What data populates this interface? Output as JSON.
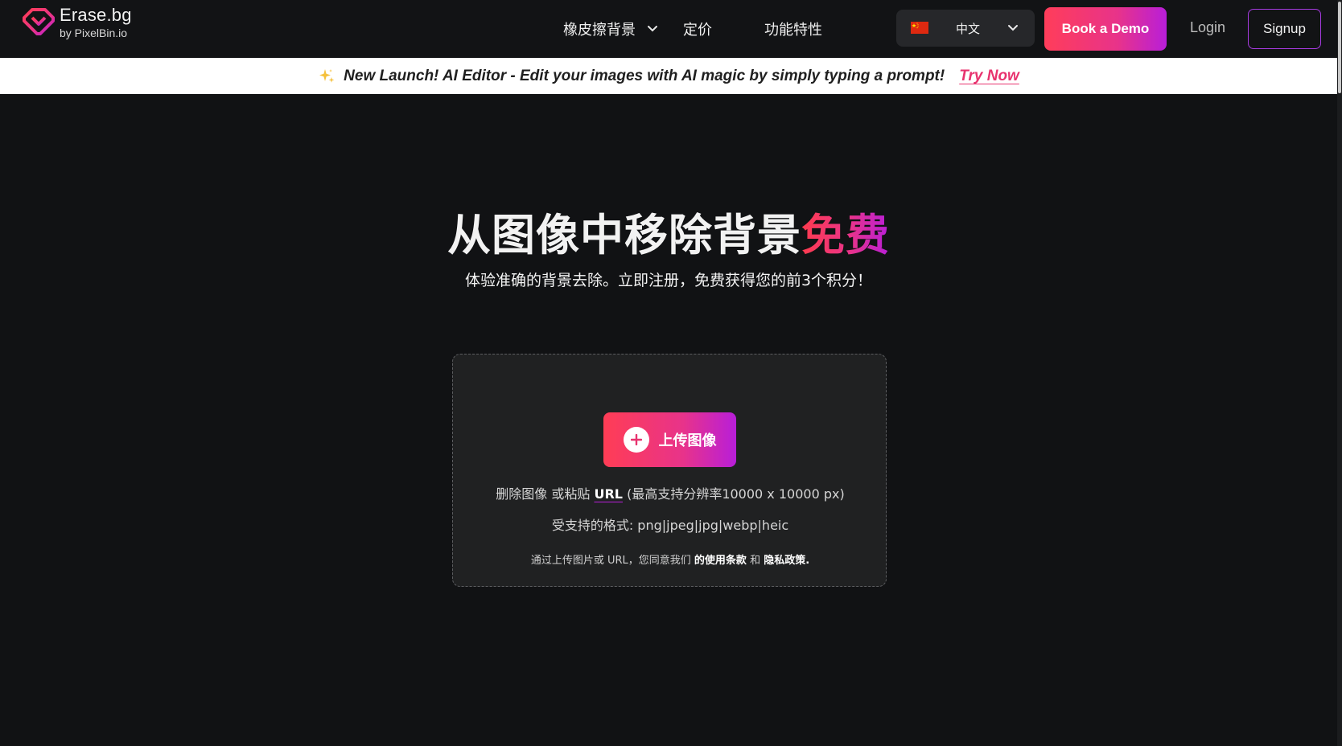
{
  "header": {
    "logo_name": "Erase.bg",
    "logo_sub": "by PixelBin.io",
    "nav": [
      {
        "label": "橡皮擦背景",
        "has_dropdown": true
      },
      {
        "label": "定价",
        "has_dropdown": false
      },
      {
        "label": "功能特性",
        "has_dropdown": false
      }
    ],
    "language": {
      "flag": "china-flag",
      "label": "中文"
    },
    "book_demo_label": "Book a Demo",
    "login_label": "Login",
    "signup_label": "Signup"
  },
  "banner": {
    "icon": "sparkle-icon",
    "text": "New Launch! AI Editor - Edit your images with AI magic by simply typing a prompt!",
    "cta": "Try Now"
  },
  "hero": {
    "title_main": "从图像中移除背景",
    "title_accent": "免费",
    "subtitle": "体验准确的背景去除。立即注册，免费获得您的前3个积分！"
  },
  "upload": {
    "button_label": "上传图像",
    "drop_text": "删除图像 或粘贴",
    "url_label": "URL",
    "resolution_text": "(最高支持分辨率10000 x 10000 px)",
    "formats_text": "受支持的格式: png|jpeg|jpg|webp|heic",
    "terms_prefix": "通过上传图片或 URL，您同意我们",
    "terms_link": "的使用条款",
    "terms_and": "和",
    "privacy_link": "隐私政策."
  },
  "colors": {
    "background": "#111214",
    "accent_start": "#ff3d55",
    "accent_mid": "#e8338a",
    "accent_end": "#b81ed9",
    "card": "#202122"
  }
}
